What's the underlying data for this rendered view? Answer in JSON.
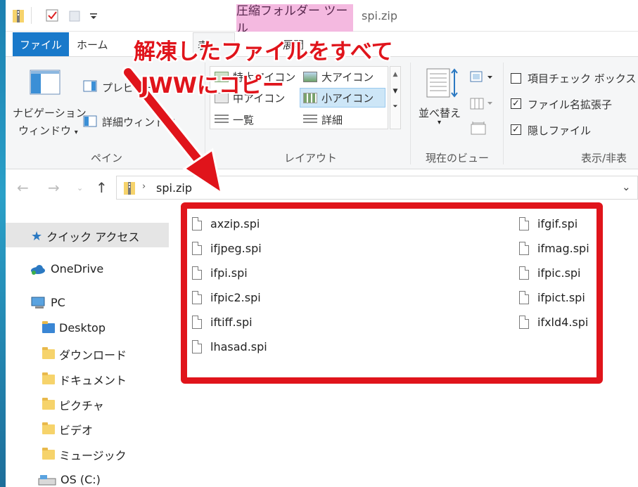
{
  "window": {
    "context_tab": "圧縮フォルダー ツール",
    "title": "spi.zip"
  },
  "tabs": {
    "file": "ファイル",
    "home": "ホーム",
    "view_partial": "表",
    "extract_partial": "展開"
  },
  "ribbon": {
    "pane": {
      "nav_window_line1": "ナビゲーション",
      "nav_window_line2": "ウィンドウ",
      "preview": "プレビュー",
      "details": "詳細ウィンドウ",
      "label": "ペイン"
    },
    "layout": {
      "xl_icons_partial": "特大アイコン",
      "large_icons": "大アイコン",
      "medium_icons": "中アイコン",
      "small_icons": "小アイコン",
      "list": "一覧",
      "details": "詳細",
      "label": "レイアウト"
    },
    "current_view": {
      "sort_by": "並べ替え",
      "label": "現在のビュー"
    },
    "show_hide": {
      "item_checkboxes": "項目チェック ボックス",
      "file_extensions": "ファイル名拡張子",
      "hidden_items": "隠しファイル",
      "label": "表示/非表"
    }
  },
  "address": {
    "path": "spi.zip"
  },
  "nav": {
    "quick_access": "クイック アクセス",
    "onedrive": "OneDrive",
    "pc": "PC",
    "desktop": "Desktop",
    "downloads": "ダウンロード",
    "documents": "ドキュメント",
    "pictures": "ピクチャ",
    "videos": "ビデオ",
    "music": "ミュージック",
    "os_drive": "OS (C:)"
  },
  "files": {
    "col1": [
      "axzip.spi",
      "ifjpeg.spi",
      "ifpi.spi",
      "ifpic2.spi",
      "iftiff.spi",
      "lhasad.spi"
    ],
    "col2": [
      "ifgif.spi",
      "ifmag.spi",
      "ifpic.spi",
      "ifpict.spi",
      "ifxld4.spi"
    ]
  },
  "annotation": {
    "line1": "解凍したファイルをすべて",
    "line2": "JWWにコピー"
  },
  "colors": {
    "accent": "#1979ca",
    "context_tab": "#f4b9e0",
    "annotation": "#e0141b",
    "selection": "#cde6f7"
  }
}
